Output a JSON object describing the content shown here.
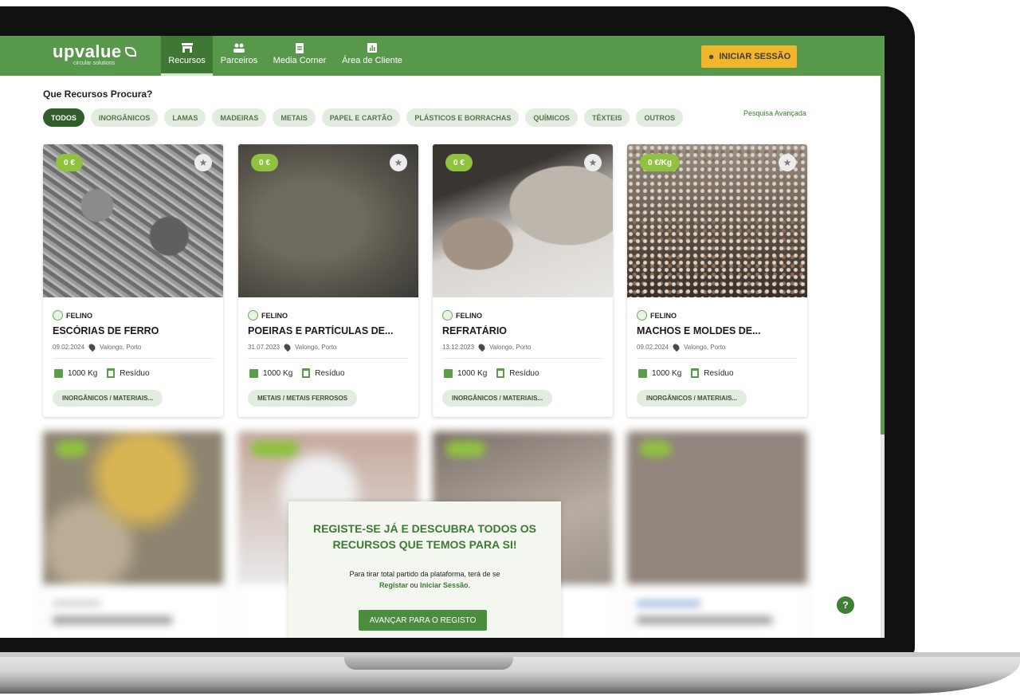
{
  "nav": {
    "logo_text": "upvalue",
    "logo_tagline": "circular solutions",
    "items": [
      {
        "label": "Recursos"
      },
      {
        "label": "Parceiros"
      },
      {
        "label": "Media Corner"
      },
      {
        "label": "Área de Cliente"
      }
    ],
    "login_label": "INICIAR SESSÃO"
  },
  "search": {
    "question": "Que Recursos Procura?",
    "filters": [
      "TODOS",
      "INORGÂNICOS",
      "LAMAS",
      "MADEIRAS",
      "METAIS",
      "PAPEL E CARTÃO",
      "PLÁSTICOS E BORRACHAS",
      "QUÍMICOS",
      "TÊXTEIS",
      "OUTROS"
    ],
    "advanced": "Pesquisa Avançada"
  },
  "cards": [
    {
      "price": "0 €",
      "owner": "FELINO",
      "title": "ESCÓRIAS DE FERRO",
      "date": "09.02.2024",
      "location": "Valongo, Porto",
      "quantity": "1000 Kg",
      "type": "Resíduo",
      "tag": "INORGÂNICOS / MATERIAIS..."
    },
    {
      "price": "0 €",
      "owner": "FELINO",
      "title": "POEIRAS E PARTÍCULAS DE...",
      "date": "31.07.2023",
      "location": "Valongo, Porto",
      "quantity": "1000 Kg",
      "type": "Resíduo",
      "tag": "METAIS / METAIS FERROSOS"
    },
    {
      "price": "0 €",
      "owner": "FELINO",
      "title": "REFRATÁRIO",
      "date": "13.12.2023",
      "location": "Valongo, Porto",
      "quantity": "1000 Kg",
      "type": "Resíduo",
      "tag": "INORGÂNICOS / MATERIAIS..."
    },
    {
      "price": "0 €/Kg",
      "owner": "FELINO",
      "title": "MACHOS E MOLDES DE...",
      "date": "09.02.2024",
      "location": "Valongo, Porto",
      "quantity": "1000 Kg",
      "type": "Resíduo",
      "tag": "INORGÂNICOS / MATERIAIS..."
    }
  ],
  "register": {
    "title_line1": "REGISTE-SE JÁ E DESCUBRA TODOS OS",
    "title_line2": "RECURSOS QUE TEMOS PARA SI!",
    "text_line1": "Para tirar total partido da plataforma, terá de se",
    "link_register": "Registar",
    "text_or": "ou",
    "link_login": "Iniciar Sessão",
    "button": "AVANÇAR PARA O REGISTO"
  },
  "help": "?"
}
